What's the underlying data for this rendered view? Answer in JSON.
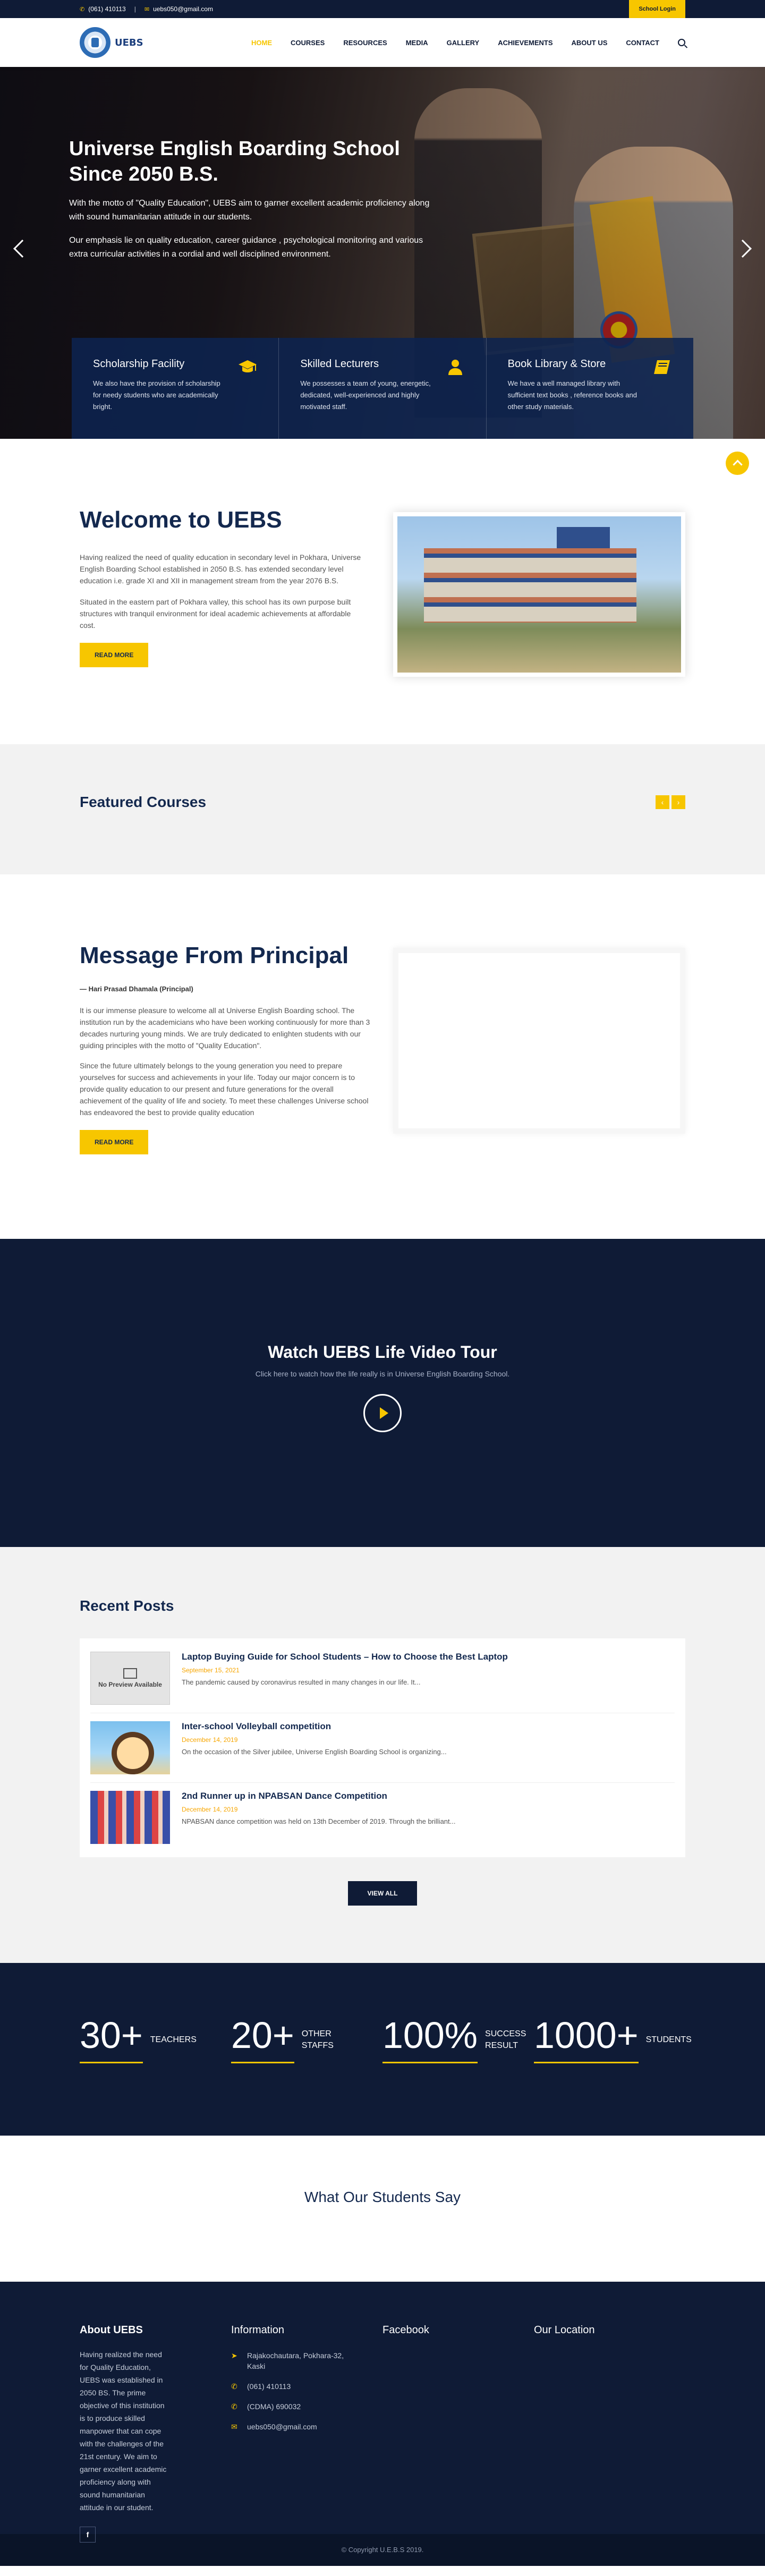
{
  "topbar": {
    "phone": "(061) 410113",
    "email": "uebs050@gmail.com",
    "login": "School Login"
  },
  "header": {
    "logo_text": "UEBS",
    "nav": [
      "HOME",
      "COURSES",
      "RESOURCES",
      "MEDIA",
      "GALLERY",
      "ACHIEVEMENTS",
      "ABOUT US",
      "CONTACT"
    ]
  },
  "hero": {
    "title": "Universe English Boarding School Since 2050 B.S.",
    "p1": "With the motto of \"Quality Education\", UEBS aim to garner excellent academic proficiency along with sound humanitarian attitude in our students.",
    "p2": "Our emphasis lie on quality education, career guidance , psychological monitoring and various extra curricular activities in a cordial and well disciplined environment.",
    "features": [
      {
        "title": "Scholarship Facility",
        "text": "We also have the provision of scholarship for needy students who are academically bright.",
        "icon": "graduation-cap-icon"
      },
      {
        "title": "Skilled Lecturers",
        "text": "We possesses a team of young, energetic, dedicated, well-experienced and highly motivated staff.",
        "icon": "user-icon"
      },
      {
        "title": "Book Library & Store",
        "text": "We have a well managed library with sufficient text books , reference books and other study materials.",
        "icon": "book-icon"
      }
    ]
  },
  "welcome": {
    "title": "Welcome to UEBS",
    "p1": "Having realized the need of quality education in secondary level in Pokhara, Universe English Boarding School established in 2050 B.S. has extended secondary level education i.e. grade XI and XII in management stream from the year 2076 B.S.",
    "p2": "Situated in the eastern part of Pokhara valley, this school has its own purpose built structures with tranquil environment for ideal academic achievements at affordable cost.",
    "button": "READ MORE"
  },
  "featured": {
    "title": "Featured Courses",
    "prev": "‹",
    "next": "›"
  },
  "principal": {
    "title": "Message From Principal",
    "signature": "— Hari Prasad Dhamala (Principal)",
    "p1": "It is our immense pleasure to welcome all at Universe English Boarding school. The institution run by the academicians who have been working continuously for more than 3 decades nurturing young minds. We are truly dedicated to enlighten students with our guiding principles with the motto of \"Quality Education\".",
    "p2": "Since the future ultimately belongs to the young generation you need to prepare yourselves for success and achievements in your life. Today our major concern is to provide quality education to our present and future generations for the overall achievement of the quality of life and society. To meet these challenges Universe school has endeavored the best to provide quality education",
    "button": "READ MORE"
  },
  "video": {
    "title": "Watch UEBS Life Video Tour",
    "subtitle": "Click here to watch how the life really is in Universe English Boarding School."
  },
  "posts": {
    "title": "Recent Posts",
    "items": [
      {
        "title": "Laptop Buying Guide for School Students – How to Choose the Best Laptop",
        "date": "September 15, 2021",
        "excerpt": "The pandemic caused by coronavirus resulted in many changes in our life. It...",
        "thumb_text": "No Preview Available"
      },
      {
        "title": "Inter-school Volleyball competition",
        "date": "December 14, 2019",
        "excerpt": "On the occasion of the Silver jubilee, Universe English Boarding School is organizing..."
      },
      {
        "title": "2nd Runner up in NPABSAN Dance Competition",
        "date": "December 14, 2019",
        "excerpt": "NPABSAN dance competition was held on 13th December of 2019. Through the brilliant..."
      }
    ],
    "view_all": "VIEW ALL"
  },
  "stats": [
    {
      "num": "30+",
      "label": "TEACHERS"
    },
    {
      "num": "20+",
      "label": "OTHER STAFFS"
    },
    {
      "num": "100%",
      "label": "SUCCESS RESULT"
    },
    {
      "num": "1000+",
      "label": "STUDENTS"
    }
  ],
  "testimonials": {
    "title": "What Our Students Say"
  },
  "footer": {
    "about_title": "About UEBS",
    "about_text": "Having realized the need for Quality Education, UEBS was established in 2050 BS. The prime objective of this institution is to produce skilled manpower that can cope with the challenges of the 21st century. We aim to garner excellent academic proficiency along with sound humanitarian attitude in our student.",
    "social": "f",
    "info_title": "Information",
    "address": "Rajakochautara, Pokhara-32, Kaski",
    "phone": "(061) 410113",
    "cdma": "(CDMA) 690032",
    "email": "uebs050@gmail.com",
    "facebook_title": "Facebook",
    "location_title": "Our Location",
    "copyright": "© Copyright U.E.B.S 2019."
  },
  "colors": {
    "navy": "#0f1b36",
    "accent": "#f7c600"
  }
}
